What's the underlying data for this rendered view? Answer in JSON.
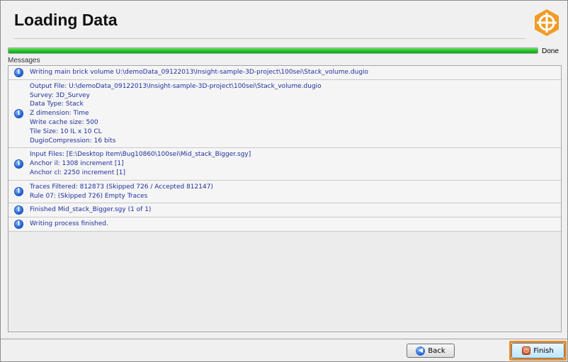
{
  "header": {
    "title": "Loading Data",
    "logo_icon": "orange-hexagon-crosshair-icon",
    "accent_color": "#f29b26"
  },
  "progress": {
    "value_percent": 100,
    "status": "Done",
    "color": "#22c022"
  },
  "messages": {
    "label": "Messages",
    "items": [
      {
        "icon": "info-icon",
        "lines": [
          "Writing main brick volume U:\\demoData_09122013\\Insight-sample-3D-project\\100sei\\Stack_volume.dugio"
        ]
      },
      {
        "icon": "info-icon",
        "lines": [
          "Output File: U:\\demoData_09122013\\Insight-sample-3D-project\\100sei\\Stack_volume.dugio",
          "Survey: 3D_Survey",
          "Data Type: Stack",
          "Z dimension: Time",
          "Write cache size: 500",
          "Tile Size: 10 IL x 10 CL",
          "DugioCompression: 16 bits"
        ]
      },
      {
        "icon": "info-icon",
        "lines": [
          "Input Files: [E:\\Desktop Item\\Bug10860\\100sei\\Mid_stack_Bigger.sgy]",
          "Anchor il: 1308 increment [1]",
          "Anchor cl: 2250 increment [1]"
        ]
      },
      {
        "icon": "info-icon",
        "lines": [
          "Traces Filtered: 812873 (Skipped 726 / Accepted 812147)",
          "Rule 07: (Skipped 726) Empty Traces"
        ]
      },
      {
        "icon": "info-icon",
        "lines": [
          "Finished Mid_stack_Bigger.sgy (1 of 1)"
        ]
      },
      {
        "icon": "info-icon",
        "lines": [
          "Writing process finished."
        ]
      }
    ]
  },
  "footer": {
    "back_label": "Back",
    "back_icon": "back-arrow-icon",
    "finish_label": "Finish",
    "finish_icon": "power-icon",
    "highlight_color": "#ef8a21"
  }
}
